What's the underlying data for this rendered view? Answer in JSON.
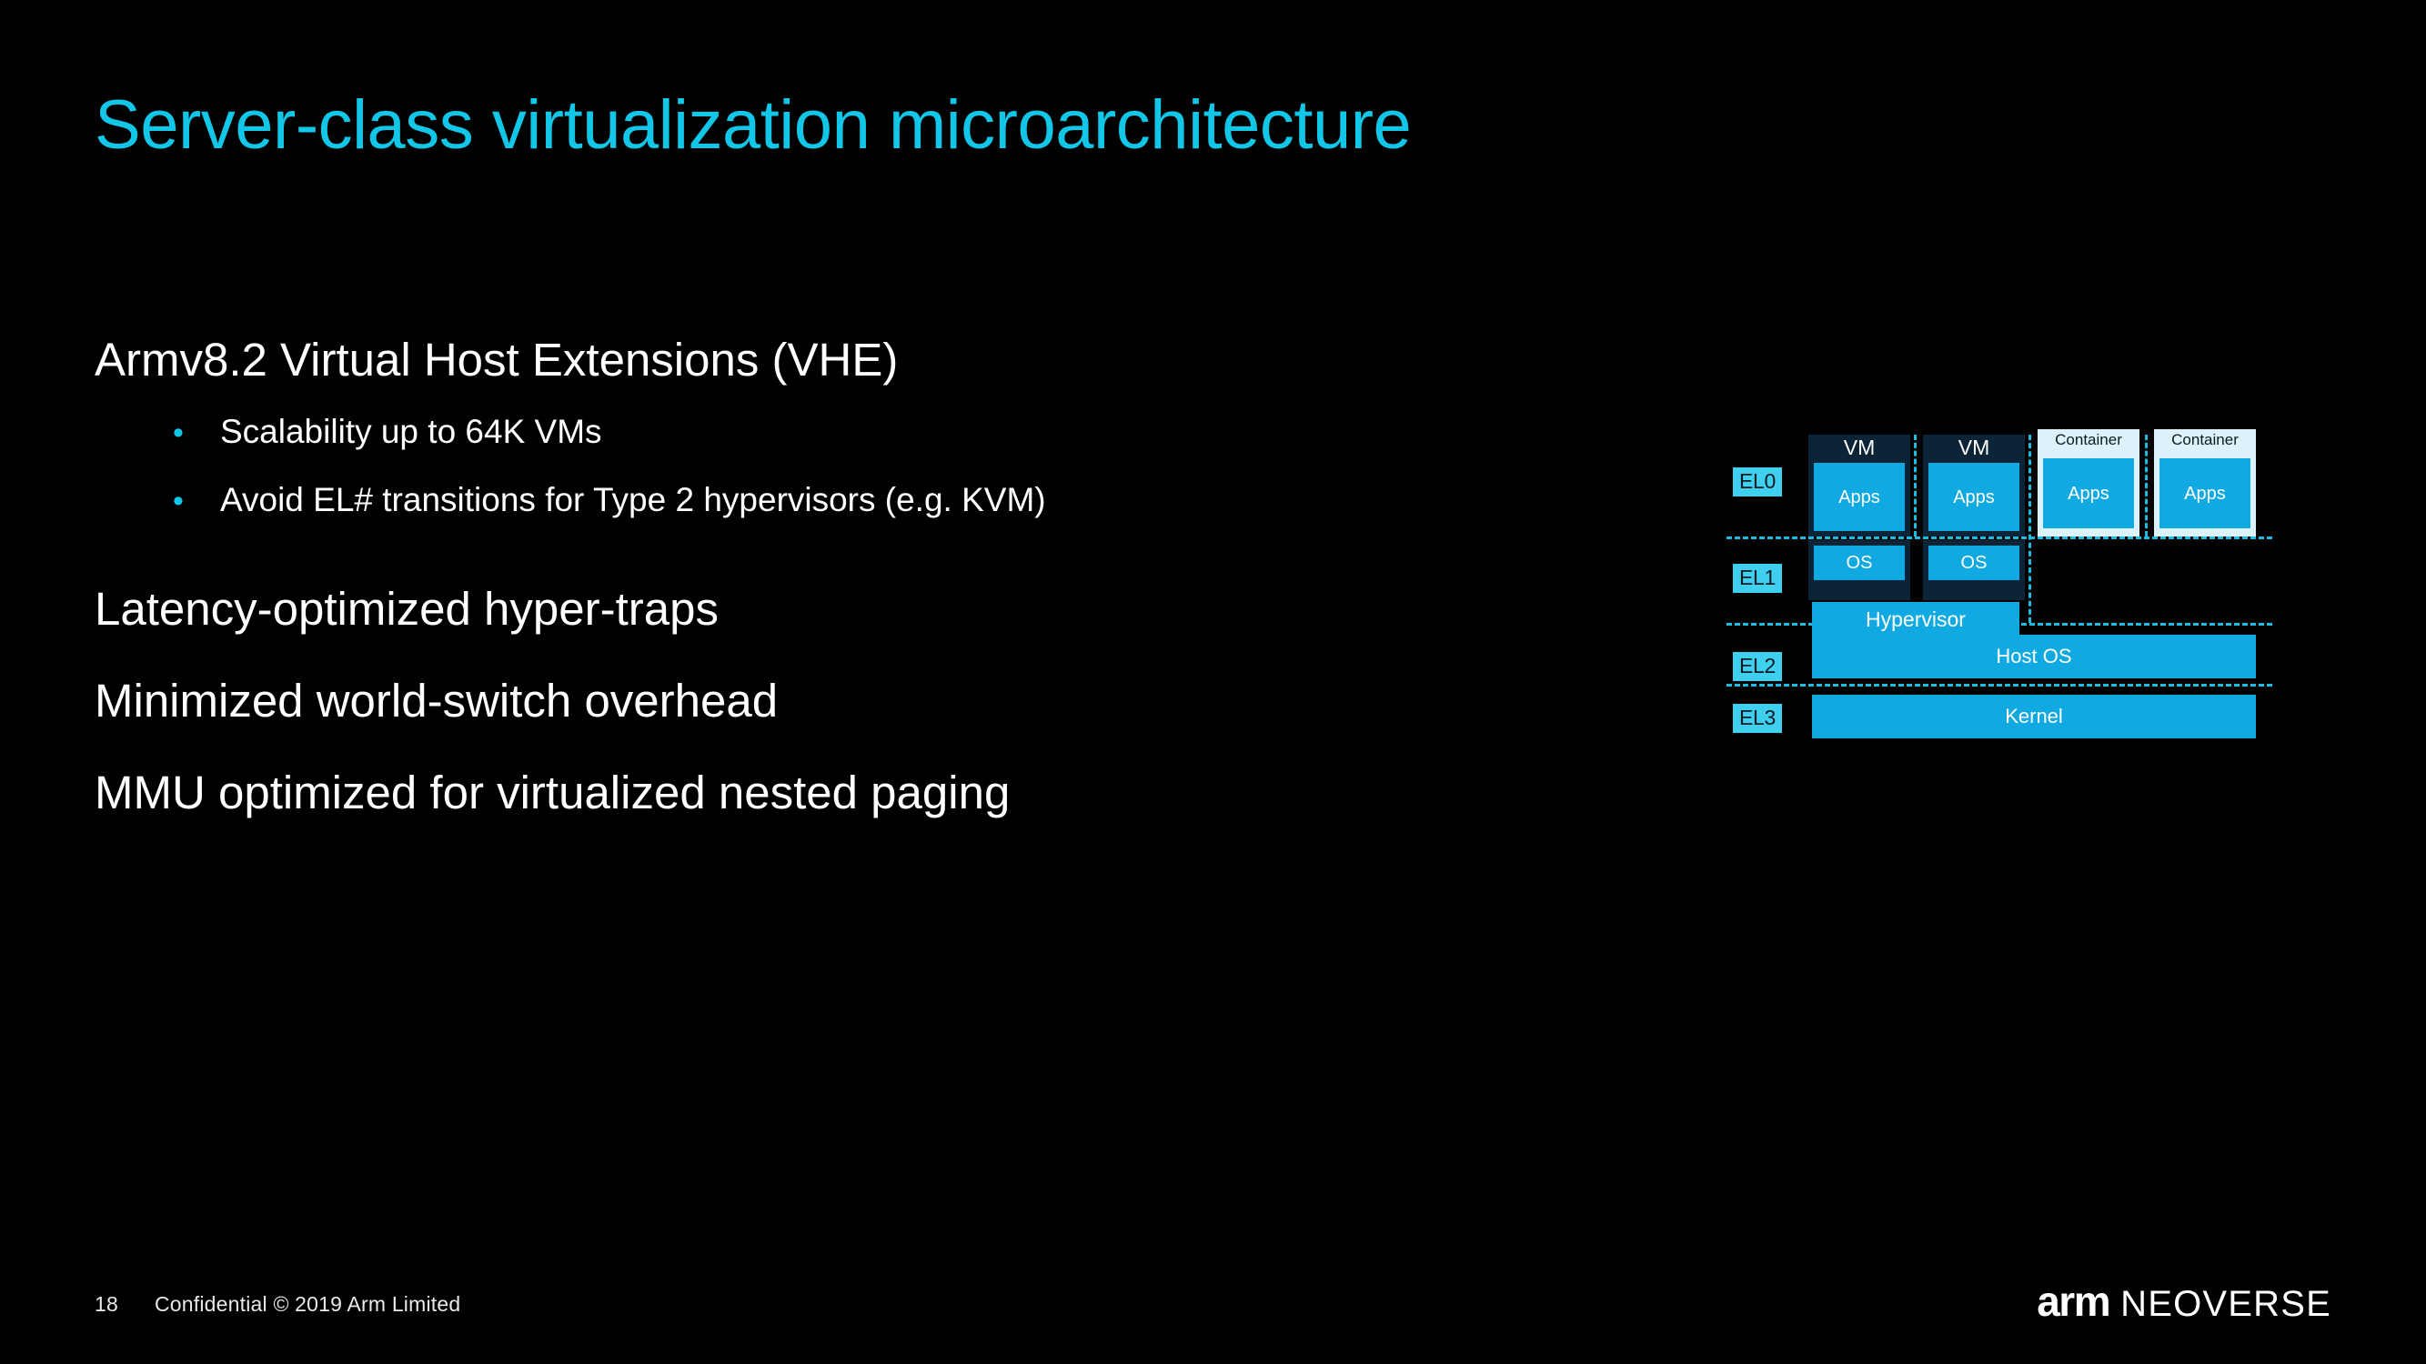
{
  "slide": {
    "title": "Server-class virtualization microarchitecture",
    "accent_color": "#12c6e8",
    "background_color": "#000000",
    "body": {
      "heading_1": "Armv8.2 Virtual Host Extensions (VHE)",
      "bullets": [
        "Scalability up to 64K VMs",
        "Avoid EL# transitions for Type 2 hypervisors (e.g. KVM)"
      ],
      "heading_2": "Latency-optimized hyper-traps",
      "heading_3": "Minimized world-switch overhead",
      "heading_4": "MMU optimized for virtualized nested paging"
    },
    "footer": {
      "page_number": "18",
      "confidential": "Confidential © 2019 Arm Limited"
    },
    "logo": {
      "arm": "arm",
      "neoverse": "NEOVERSE"
    }
  },
  "diagram": {
    "exception_levels": [
      {
        "label": "EL0"
      },
      {
        "label": "EL1"
      },
      {
        "label": "EL2"
      },
      {
        "label": "EL3"
      }
    ],
    "columns": [
      {
        "type": "vm",
        "title": "VM",
        "apps": "Apps",
        "os": "OS"
      },
      {
        "type": "vm",
        "title": "VM",
        "apps": "Apps",
        "os": "OS"
      },
      {
        "type": "container",
        "title": "Container",
        "apps": "Apps"
      },
      {
        "type": "container",
        "title": "Container",
        "apps": "Apps"
      }
    ],
    "hypervisor": "Hypervisor",
    "host_os": "Host OS",
    "kernel": "Kernel",
    "colors": {
      "cyan": "#10a9e2",
      "vm_shell": "#0c2437",
      "container_shell": "#ddf3fc",
      "el_badge": "#3fd0ef",
      "dash": "#19bde2"
    }
  }
}
